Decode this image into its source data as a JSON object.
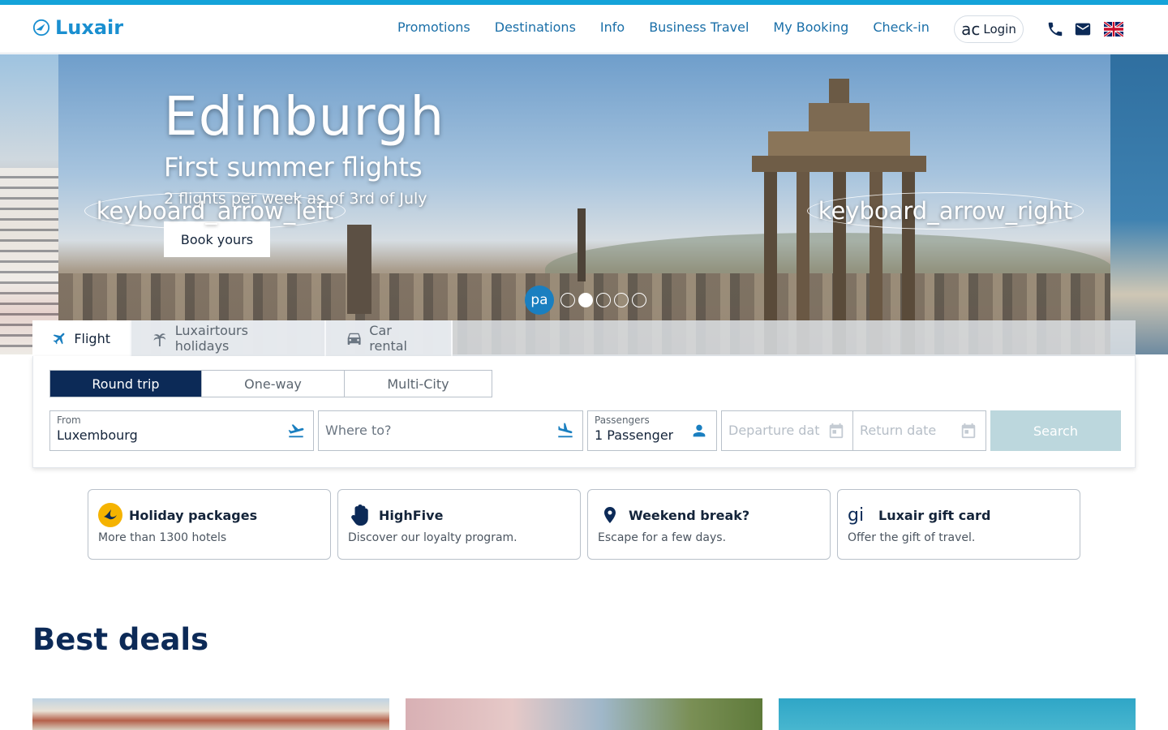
{
  "brand": {
    "name": "Luxair",
    "color": "#1a8fd0"
  },
  "nav": [
    {
      "label": "Promotions"
    },
    {
      "label": "Destinations"
    },
    {
      "label": "Info"
    },
    {
      "label": "Business Travel"
    },
    {
      "label": "My Booking"
    },
    {
      "label": "Check-in"
    }
  ],
  "login": {
    "icon_text": "ac",
    "label": "Login"
  },
  "header_icons": [
    "phone-icon",
    "mail-icon",
    "uk-flag-icon"
  ],
  "hero": {
    "title": "Edinburgh",
    "subtitle": "First summer flights",
    "text": "2 flights per week as of 3rd of July",
    "cta": "Book yours",
    "prev_label": "keyboard_arrow_left",
    "next_label": "keyboard_arrow_right",
    "pause_label": "pa",
    "slides": 5,
    "active_slide": 2
  },
  "tabs": [
    {
      "label": "Flight",
      "icon": "plane-icon",
      "active": true
    },
    {
      "label": "Luxairtours holidays",
      "icon": "palm-icon",
      "active": false
    },
    {
      "label": "Car rental",
      "icon": "car-icon",
      "active": false
    }
  ],
  "trip_types": [
    {
      "label": "Round trip",
      "selected": true
    },
    {
      "label": "One-way",
      "selected": false
    },
    {
      "label": "Multi-City",
      "selected": false
    }
  ],
  "form": {
    "from_label": "From",
    "from_value": "Luxembourg",
    "to_placeholder": "Where to?",
    "passengers_label": "Passengers",
    "passengers_value": "1 Passenger",
    "departure_placeholder": "Departure dat",
    "return_placeholder": "Return date",
    "search": "Search"
  },
  "cards": [
    {
      "title": "Holiday packages",
      "subtitle": "More than 1300 hotels",
      "icon": "luxairtours-icon"
    },
    {
      "title": "HighFive",
      "subtitle": "Discover our loyalty program.",
      "icon": "hand-icon"
    },
    {
      "title": "Weekend break?",
      "subtitle": "Escape for a few days.",
      "icon": "location-pin-icon"
    },
    {
      "title": "Luxair gift card",
      "subtitle": "Offer the gift of travel.",
      "icon_text": "gi",
      "icon": "gift-icon"
    }
  ],
  "deals_title": "Best deals",
  "colors": {
    "accent": "#14a3d9",
    "navy": "#0c2a57",
    "link": "#1a6fa8",
    "search_disabled": "#bcd7dd"
  }
}
